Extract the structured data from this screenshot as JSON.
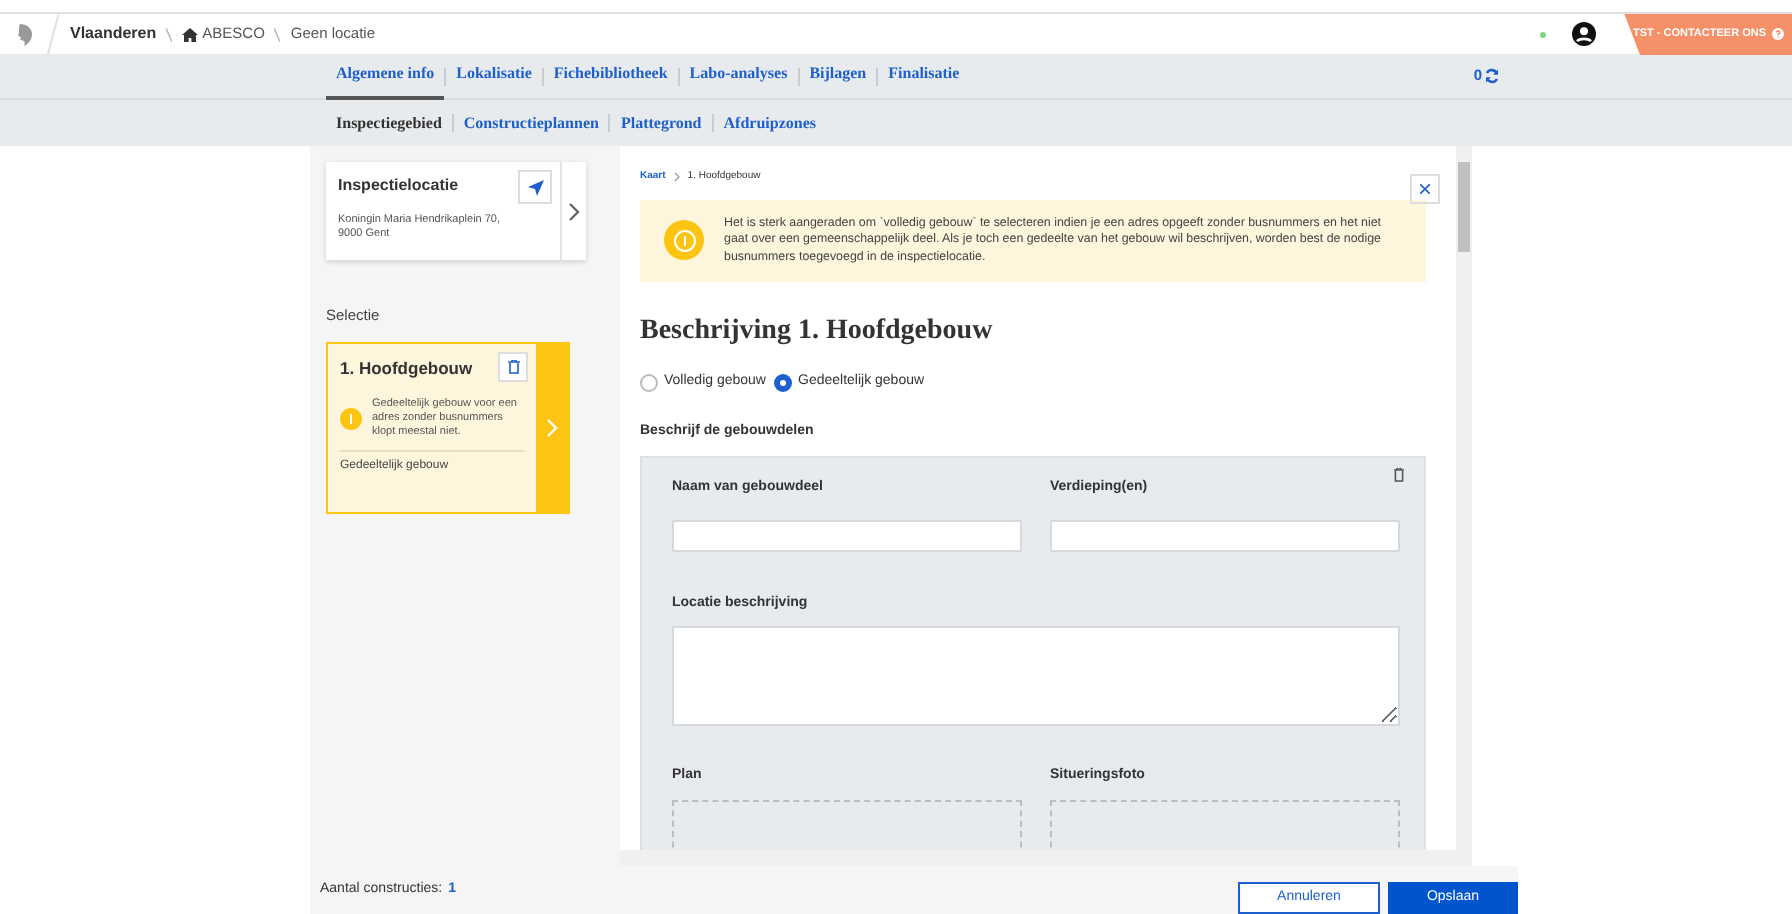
{
  "header": {
    "breadcrumb": [
      {
        "label": "Vlaanderen",
        "kind": "brand"
      },
      {
        "label": "ABESCO",
        "kind": "home"
      },
      {
        "label": "Geen locatie",
        "kind": "plain"
      }
    ],
    "online": true,
    "env_badge": "TST - CONTACTEER ONS"
  },
  "tabs": [
    {
      "label": "Algemene info",
      "selected": true
    },
    {
      "label": "Lokalisatie",
      "selected": false
    },
    {
      "label": "Fichebibliotheek",
      "selected": false
    },
    {
      "label": "Labo-analyses",
      "selected": false
    },
    {
      "label": "Bijlagen",
      "selected": false
    },
    {
      "label": "Finalisatie",
      "selected": false
    }
  ],
  "sync_count": "0",
  "subtabs": [
    {
      "label": "Inspectiegebied",
      "selected": true
    },
    {
      "label": "Constructieplannen",
      "selected": false
    },
    {
      "label": "Plattegrond",
      "selected": false
    },
    {
      "label": "Afdruipzones",
      "selected": false
    }
  ],
  "location_card": {
    "title": "Inspectielocatie",
    "address": [
      "Koningin Maria Hendrikaplein 70,",
      "9000 Gent"
    ]
  },
  "selection_label": "Selectie",
  "constructions": [
    {
      "title": "1. Hoofdgebouw",
      "warning": "Gedeeltelijk gebouw voor een adres zonder busnummers klopt meestal niet.",
      "type": "Gedeeltelijk gebouw",
      "selected": true
    }
  ],
  "detail": {
    "breadcrumb": [
      "Kaart",
      "1. Hoofdgebouw"
    ],
    "alert": "Het is sterk aangeraden om `volledig gebouw` te selecteren indien je een adres opgeeft zonder busnummers en het niet gaat over een gemeenschappelijk deel. Als je toch een gedeelte van het gebouw wil beschrijven, worden best de nodige busnummers toegevoegd in de inspectielocatie.",
    "heading": "Beschrijving 1. Hoofdgebouw",
    "radios": [
      {
        "label": "Volledig gebouw",
        "selected": false
      },
      {
        "label": "Gedeeltelijk gebouw",
        "selected": true
      }
    ],
    "section_label": "Beschrijf de gebouwdelen",
    "fields": [
      {
        "label": "Naam van gebouwdeel",
        "kind": "text"
      },
      {
        "label": "Verdieping(en)",
        "kind": "text"
      },
      {
        "label": "Locatie beschrijving",
        "kind": "textarea"
      },
      {
        "label": "Plan",
        "kind": "upload"
      },
      {
        "label": "Situeringsfoto",
        "kind": "upload"
      }
    ]
  },
  "footer": {
    "count_label": "Aantal constructies:",
    "count": "1",
    "buttons": [
      {
        "label": "Annuleren",
        "kind": "secondary"
      },
      {
        "label": "Opslaan",
        "kind": "primary"
      }
    ]
  }
}
